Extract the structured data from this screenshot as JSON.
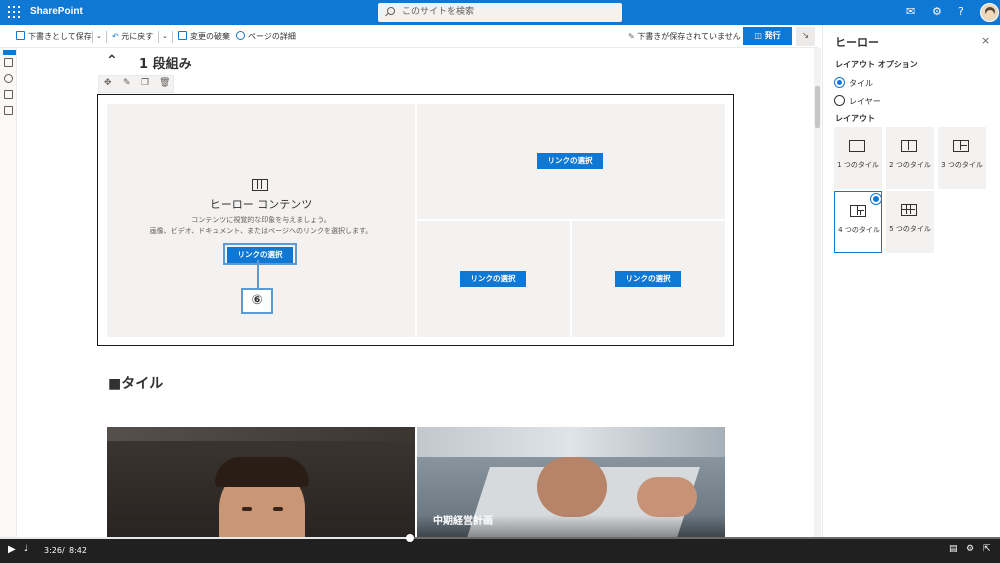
{
  "suite": {
    "brand": "SharePoint",
    "search_placeholder": "このサイトを検索"
  },
  "commands": {
    "save_draft": "下書きとして保存",
    "undo": "元に戻す",
    "discard": "変更の破棄",
    "page_details": "ページの詳細",
    "draft_status": "下書きが保存されていません",
    "publish": "発行"
  },
  "section": {
    "title": "1 段組み"
  },
  "hero": {
    "heading": "ヒーロー コンテンツ",
    "desc1": "コンテンツに視覚的な印象を与えましょう。",
    "desc2": "画像、ビデオ、ドキュメント、またはページへのリンクを選択します。",
    "link_labels": [
      "リンクの選択",
      "リンクの選択",
      "リンクの選択",
      "リンクの選択"
    ],
    "callout": "⑥"
  },
  "heading2": "■タイル",
  "photo_caption": "中期経営計画",
  "panel": {
    "title": "ヒーロー",
    "layout_options_label": "レイアウト オプション",
    "option_tile": "タイル",
    "option_layer": "レイヤー",
    "layout_label": "レイアウト",
    "layouts": [
      "1 つのタイル",
      "2 つのタイル",
      "3 つのタイル",
      "4 つのタイル",
      "5 つのタイル"
    ],
    "selected_layout_index": 3,
    "selected_option": "タイル"
  },
  "video": {
    "current_time": "3:26",
    "sep": "/",
    "duration": "8:42",
    "progress": 0.41
  }
}
